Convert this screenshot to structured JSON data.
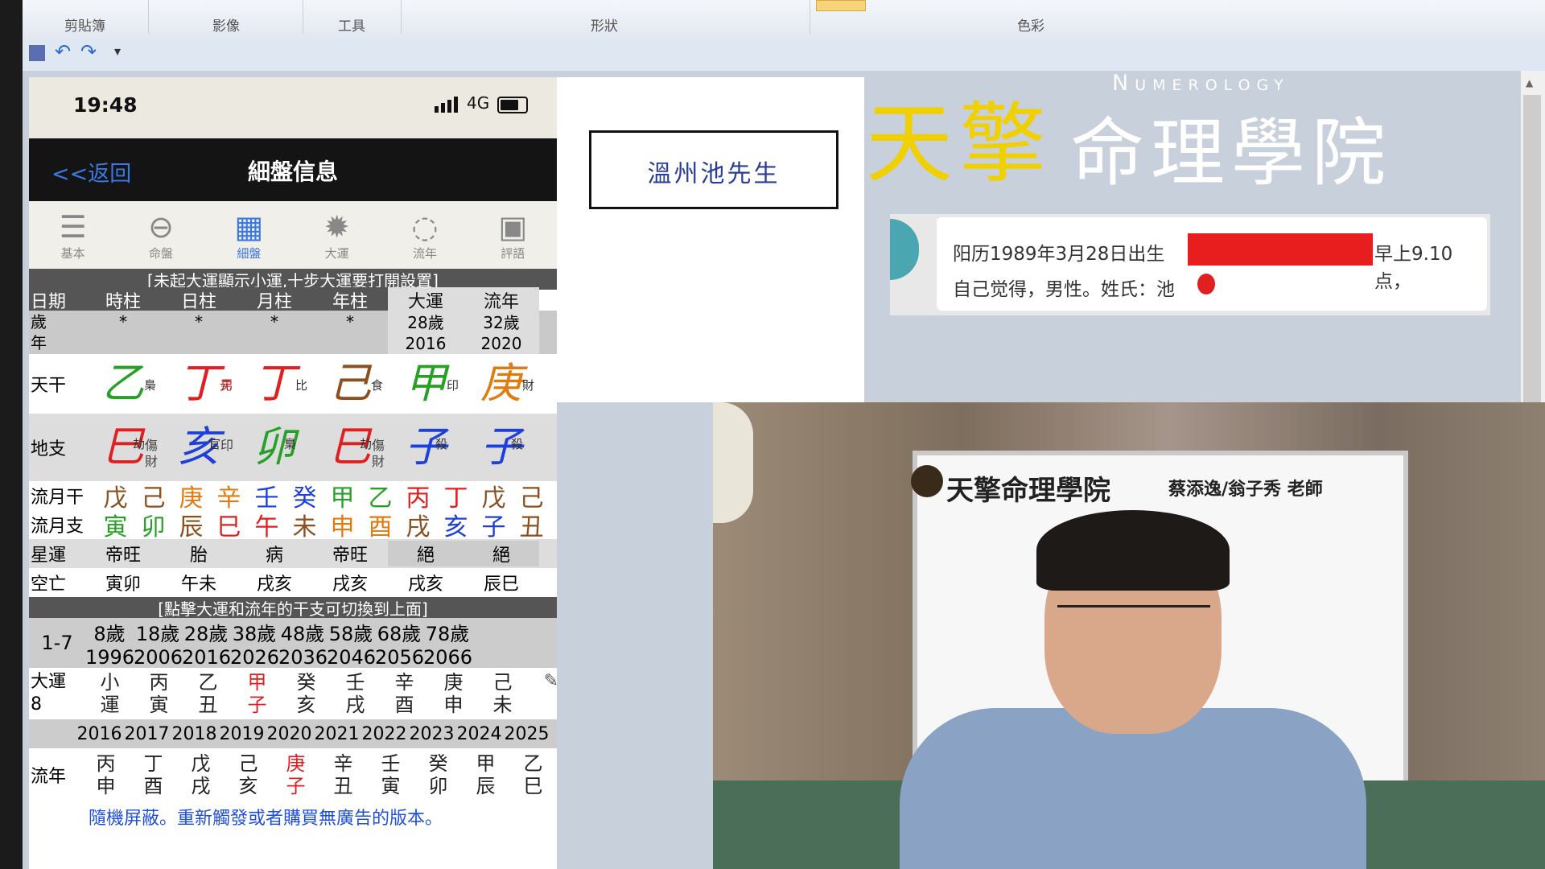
{
  "ribbon": {
    "groups": [
      "剪貼簿",
      "影像",
      "工具",
      "形狀",
      "色彩"
    ]
  },
  "phone": {
    "status": {
      "time": "19:48",
      "network": "4G",
      "battery_level": 0.8
    },
    "nav": {
      "back": "<<返回",
      "title": "細盤信息"
    },
    "tabs": [
      {
        "label": "基本",
        "icon": "person-list-icon"
      },
      {
        "label": "命盤",
        "icon": "circle-minus-icon"
      },
      {
        "label": "細盤",
        "icon": "calendar-grid-icon",
        "active": true
      },
      {
        "label": "大運",
        "icon": "sun-icon"
      },
      {
        "label": "流年",
        "icon": "dotted-circle-icon"
      },
      {
        "label": "評語",
        "icon": "picture-icon"
      }
    ],
    "notice_top": "[未起大運顯示小運,十步大運要打開設置]",
    "headers": [
      "日期",
      "時柱",
      "日柱",
      "月柱",
      "年柱",
      "大運",
      "流年"
    ],
    "sui": "歲",
    "nian": "年",
    "stars": [
      "*",
      "*",
      "*",
      "*"
    ],
    "dayun_age": "28歲",
    "dayun_year": "2016",
    "liunian_age": "32歲",
    "liunian_year": "2020",
    "tiangan_label": "天干",
    "tiangan": [
      {
        "char": "乙",
        "sup": "梟",
        "color": "green"
      },
      {
        "char": "丁",
        "sup": "元",
        "sub": "男",
        "color": "red"
      },
      {
        "char": "丁",
        "sup": "比",
        "color": "red"
      },
      {
        "char": "己",
        "sup": "食",
        "color": "brown"
      },
      {
        "char": "甲",
        "sup": "印",
        "color": "green"
      },
      {
        "char": "庚",
        "sup": "財",
        "color": "orange"
      }
    ],
    "dizhi_label": "地支",
    "dizhi": [
      {
        "char": "巳",
        "sup": "劫",
        "subs": "傷\n財",
        "color": "red"
      },
      {
        "char": "亥",
        "sup": "官",
        "subs": "印",
        "color": "blue"
      },
      {
        "char": "卯",
        "sup": "梟",
        "color": "green"
      },
      {
        "char": "巳",
        "sup": "劫",
        "subs": "傷\n財",
        "color": "red"
      },
      {
        "char": "子",
        "sup": "殺",
        "color": "blue"
      },
      {
        "char": "子",
        "sup": "殺",
        "color": "blue"
      }
    ],
    "liuyuegan_label": "流月干",
    "liuyuegan": [
      {
        "c": "戊",
        "color": "brown"
      },
      {
        "c": "己",
        "color": "brown"
      },
      {
        "c": "庚",
        "color": "orange"
      },
      {
        "c": "辛",
        "color": "orange"
      },
      {
        "c": "壬",
        "color": "blue"
      },
      {
        "c": "癸",
        "color": "blue"
      },
      {
        "c": "甲",
        "color": "green"
      },
      {
        "c": "乙",
        "color": "green"
      },
      {
        "c": "丙",
        "color": "red"
      },
      {
        "c": "丁",
        "color": "red"
      },
      {
        "c": "戊",
        "color": "brown"
      },
      {
        "c": "己",
        "color": "brown"
      }
    ],
    "liuyuezhi_label": "流月支",
    "liuyuezhi": [
      {
        "c": "寅",
        "color": "green"
      },
      {
        "c": "卯",
        "color": "green"
      },
      {
        "c": "辰",
        "color": "brown"
      },
      {
        "c": "巳",
        "color": "red"
      },
      {
        "c": "午",
        "color": "red"
      },
      {
        "c": "未",
        "color": "brown"
      },
      {
        "c": "申",
        "color": "orange"
      },
      {
        "c": "酉",
        "color": "orange"
      },
      {
        "c": "戌",
        "color": "brown"
      },
      {
        "c": "亥",
        "color": "blue"
      },
      {
        "c": "子",
        "color": "blue"
      },
      {
        "c": "丑",
        "color": "brown"
      }
    ],
    "xingyun_label": "星運",
    "xingyun": [
      "帝旺",
      "胎",
      "病",
      "帝旺",
      "絕",
      "絕"
    ],
    "kongwang_label": "空亡",
    "kongwang": [
      "寅卯",
      "午未",
      "戌亥",
      "戌亥",
      "戌亥",
      "辰巳"
    ],
    "notice_mid": "[點擊大運和流年的干支可切換到上面]",
    "dayun_range": "1-7",
    "dayun_ages": [
      "8歲",
      "18歲",
      "28歲",
      "38歲",
      "48歲",
      "58歲",
      "68歲",
      "78歲"
    ],
    "dayun_years": [
      "1996",
      "2006",
      "2016",
      "2026",
      "2036",
      "2046",
      "2056",
      "2066"
    ],
    "dayun_label": "大運",
    "dayun_label_num": "8",
    "dayun_cols": [
      {
        "t": "小",
        "b": "運",
        "color": "dark"
      },
      {
        "t": "丙",
        "b": "寅",
        "color": "dark"
      },
      {
        "t": "乙",
        "b": "丑",
        "color": "dark"
      },
      {
        "t": "甲",
        "b": "子",
        "color": "red"
      },
      {
        "t": "癸",
        "b": "亥",
        "color": "dark"
      },
      {
        "t": "壬",
        "b": "戌",
        "color": "dark"
      },
      {
        "t": "辛",
        "b": "酉",
        "color": "dark"
      },
      {
        "t": "庚",
        "b": "申",
        "color": "dark"
      },
      {
        "t": "己",
        "b": "未",
        "color": "dark"
      }
    ],
    "liunian_years": [
      "2016",
      "2017",
      "2018",
      "2019",
      "2020",
      "2021",
      "2022",
      "2023",
      "2024",
      "2025"
    ],
    "liunian_label": "流年",
    "liunian_cols": [
      {
        "t": "丙",
        "b": "申",
        "color": "dark"
      },
      {
        "t": "丁",
        "b": "酉",
        "color": "dark"
      },
      {
        "t": "戊",
        "b": "戌",
        "color": "dark"
      },
      {
        "t": "己",
        "b": "亥",
        "color": "dark"
      },
      {
        "t": "庚",
        "b": "子",
        "color": "red"
      },
      {
        "t": "辛",
        "b": "丑",
        "color": "dark"
      },
      {
        "t": "壬",
        "b": "寅",
        "color": "dark"
      },
      {
        "t": "癸",
        "b": "卯",
        "color": "dark"
      },
      {
        "t": "甲",
        "b": "辰",
        "color": "dark"
      },
      {
        "t": "乙",
        "b": "巳",
        "color": "dark"
      }
    ],
    "footer": "隨機屏蔽。重新觸發或者購買無廣告的版本。"
  },
  "namecard": "溫州池先生",
  "brand": {
    "yellow": "天擎",
    "white": "命理學院",
    "english": "Numerology"
  },
  "chat": {
    "line1_a": "阳历1989年3月28日出生",
    "line1_b": "早上9.10点，",
    "line2": "自己觉得，男性。姓氏：池"
  },
  "video": {
    "board_title": "天擎命理學院",
    "board_sub": "蔡添逸/翁子秀 老師"
  },
  "colors": {
    "green": "#28a028",
    "red": "#e02020",
    "orange": "#e07b10",
    "blue": "#1e40d8",
    "brown": "#8a5020",
    "dark": "#222222"
  }
}
